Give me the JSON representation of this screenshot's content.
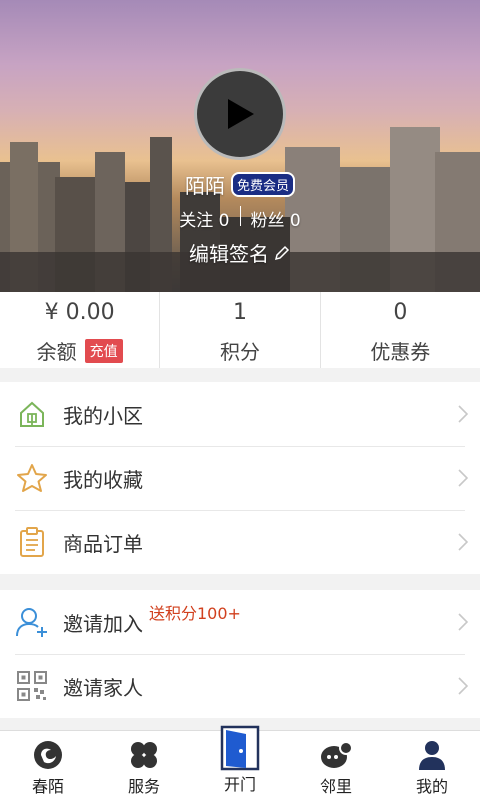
{
  "profile": {
    "name": "陌陌",
    "member_badge": "免费会员",
    "follow_label": "关注",
    "follow_count": "0",
    "fans_label": "粉丝",
    "fans_count": "0",
    "signature": "编辑签名"
  },
  "stats": {
    "balance_value": "¥ 0.00",
    "balance_label": "余额",
    "recharge_label": "充值",
    "points_value": "1",
    "points_label": "积分",
    "coupon_value": "0",
    "coupon_label": "优惠券"
  },
  "menu_group1": [
    {
      "label": "我的小区",
      "icon": "community-icon"
    },
    {
      "label": "我的收藏",
      "icon": "star-icon"
    },
    {
      "label": "商品订单",
      "icon": "clipboard-icon"
    }
  ],
  "menu_group2": [
    {
      "label": "邀请加入",
      "icon": "add-user-icon",
      "bonus": "送积分100+"
    },
    {
      "label": "邀请家人",
      "icon": "qrcode-icon"
    }
  ],
  "tabbar": [
    {
      "label": "春陌",
      "icon": "chunmo-icon"
    },
    {
      "label": "服务",
      "icon": "services-icon"
    },
    {
      "label": "开门",
      "icon": "door-icon"
    },
    {
      "label": "邻里",
      "icon": "neighbor-icon"
    },
    {
      "label": "我的",
      "icon": "user-icon",
      "active": true
    }
  ],
  "colors": {
    "accent_red": "#e24b4f",
    "badge_blue": "#1a2d84",
    "bonus_orange": "#d1401e",
    "tab_dark": "#22325c"
  }
}
